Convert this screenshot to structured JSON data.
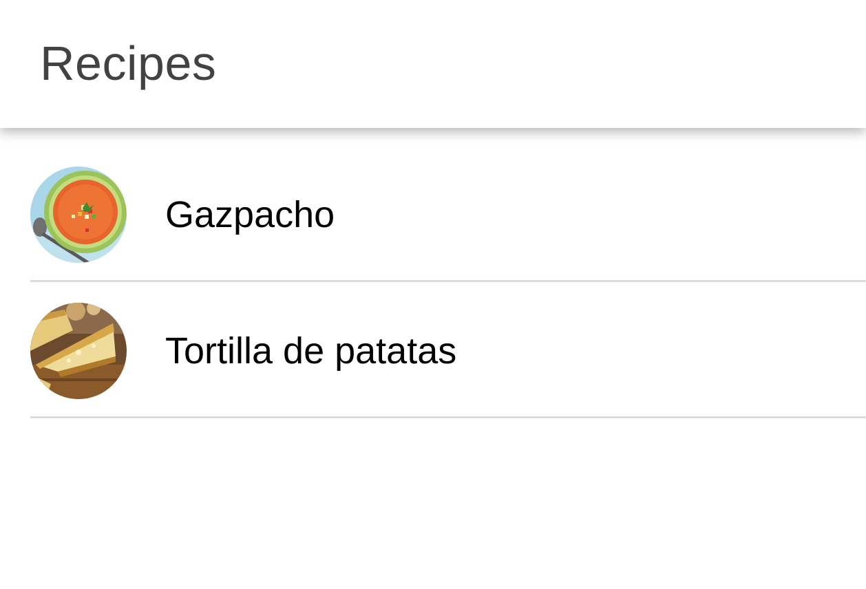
{
  "header": {
    "title": "Recipes"
  },
  "recipes": [
    {
      "name": "Gazpacho",
      "image": "gazpacho-bowl"
    },
    {
      "name": "Tortilla de patatas",
      "image": "tortilla-slice"
    }
  ],
  "colors": {
    "title": "#424242",
    "text": "#000000",
    "divider": "#dcdcdc",
    "background": "#ffffff"
  }
}
